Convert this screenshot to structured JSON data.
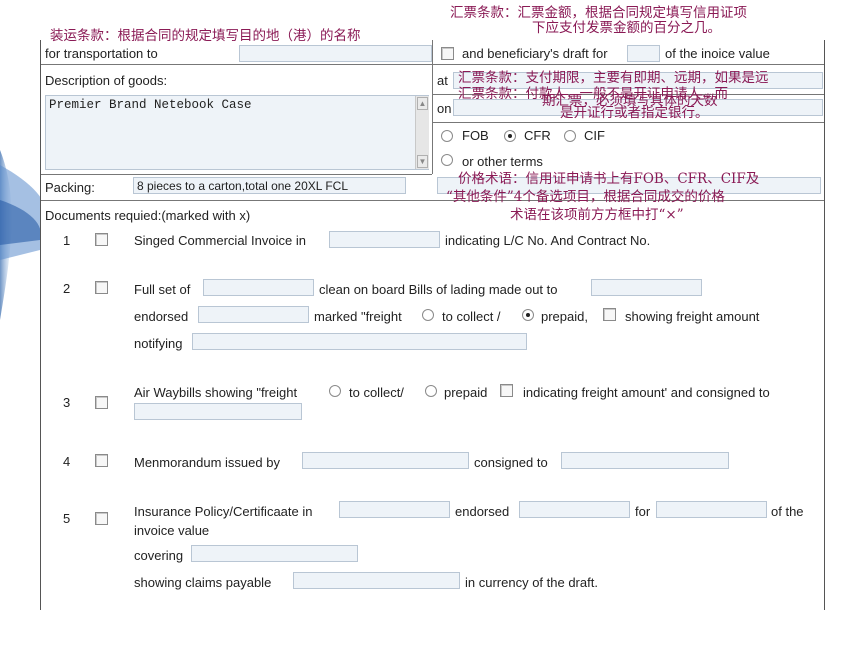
{
  "annotations": {
    "shipping_clause": "装运条款：根据合同的规定填写目的地（港）的名称",
    "draft_amount_l1": "汇票条款：汇票金额，根据合同规定填写信用证项",
    "draft_amount_l2": "下应支付发票金额的百分之几。",
    "tenor_a_l1": "汇票条款：支付期限，主要有即期、远期，如果是远",
    "tenor_a_l2": "期汇票，必须填写具体的天数",
    "tenor_b_l1": "汇票条款：付款人，一般不是开证申请人，而",
    "tenor_b_l2": "是开证行或者指定银行。",
    "price_l1": "价格术语：信用证申请书上有FOB、CFR、CIF及",
    "price_l2": "“其他条件”4个备选项目，根据合同成交的价格",
    "price_l3": "术语在该项前方方框中打“×”"
  },
  "form": {
    "transport_label": "for transportation to",
    "draft_text_1": "and beneficiary's draft for",
    "draft_text_2": "of the inoice value",
    "at_label": "at",
    "on_label": "on",
    "goods_label": "Description of goods:",
    "goods_value": "Premier Brand Netebook Case",
    "packing_label": "Packing:",
    "packing_value": "8 pieces to a carton,total one 20XL FCL",
    "fob": "FOB",
    "cfr": "CFR",
    "cif": "CIF",
    "other_terms": "or other terms",
    "docs_header": "Documents requied:(marked with x)",
    "d1_num": "1",
    "d1_a": "Singed Commercial Invoice in",
    "d1_b": "indicating L/C No. And Contract No.",
    "d2_num": "2",
    "d2_a": "Full set of",
    "d2_b": "clean on board Bills of lading made out to",
    "d2_c": "endorsed",
    "d2_d": "marked \"freight",
    "d2_e": "to collect /",
    "d2_f": "prepaid,",
    "d2_g": "showing freight amount",
    "d2_h": "notifying",
    "d3_num": "3",
    "d3_a": "Air Waybills showing \"freight",
    "d3_b": "to collect/",
    "d3_c": "prepaid",
    "d3_d": "indicating freight amount' and consigned to",
    "d4_num": "4",
    "d4_a": "Menmorandum issued by",
    "d4_b": "consigned to",
    "d5_num": "5",
    "d5_a": "Insurance Policy/Certificaate in",
    "d5_b": "endorsed",
    "d5_c": "for",
    "d5_d": "of the",
    "d5_e": "invoice value",
    "d5_f": "covering",
    "d5_g": "showing claims payable",
    "d5_h": "in currency of the draft."
  }
}
